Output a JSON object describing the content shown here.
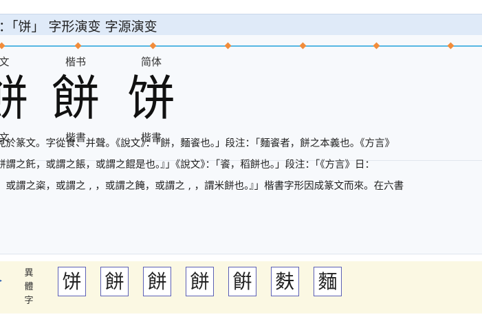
{
  "header": {
    "title": "：「饼」 字形演变 字源演变"
  },
  "evolution": {
    "stages": [
      {
        "top": "文",
        "glyph": "餅",
        "bottom": "文"
      },
      {
        "top": "楷书",
        "glyph": "餅",
        "bottom": "楷書"
      },
      {
        "top": "简体",
        "glyph": "饼",
        "bottom": "楷書"
      }
    ]
  },
  "description": {
    "lines": [
      "見於篆文。字從食、并聲。《說文》：「餅，麵餈也。」段注：「麵餈者，餅之本義也。《方言》",
      "餅謂之飥，或謂之餦，或謂之餛是也。』」《說文》：「餈，稻餅也。」段注：「《方言》日：",
      "，或謂之粢，或謂之 , ，或謂之餣，或謂之 , ，謂米餅也。』」楷書字形因成篆文而來。在六書"
    ]
  },
  "variants": {
    "label": "異體字",
    "items": [
      "饼",
      "餅",
      "餅",
      "餅",
      "餠",
      "麩",
      "麵"
    ]
  },
  "colors": {
    "header_bg": "#dfeaf8",
    "timeline": "#55b7e3",
    "marker": "#f28c3a",
    "variant_bg": "#fbf8e3"
  }
}
